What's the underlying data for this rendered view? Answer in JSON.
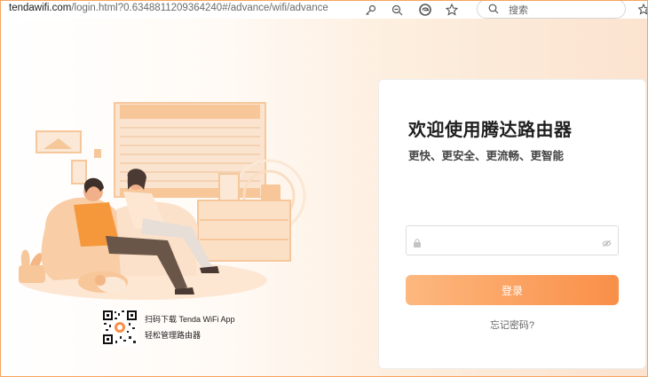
{
  "browser": {
    "url_host": "tendawifi.com",
    "url_rest": "/login.html?0.6348811209364240#/advance/wifi/advance",
    "search_placeholder": "搜索",
    "icons": [
      "key-icon",
      "zoom-out-icon",
      "edge-icon",
      "star-icon",
      "favorites-icon"
    ]
  },
  "login": {
    "title": "欢迎使用腾达路由器",
    "subtitle": "更快、更安全、更流畅、更智能",
    "password_value": "",
    "login_button": "登录",
    "forgot_link": "忘记密码?"
  },
  "app_promo": {
    "line1": "扫码下载 Tenda WiFi App",
    "line2": "轻松管理路由器"
  },
  "colors": {
    "accent_start": "#fdb87f",
    "accent_end": "#f98f48",
    "border": "#f4a463"
  }
}
